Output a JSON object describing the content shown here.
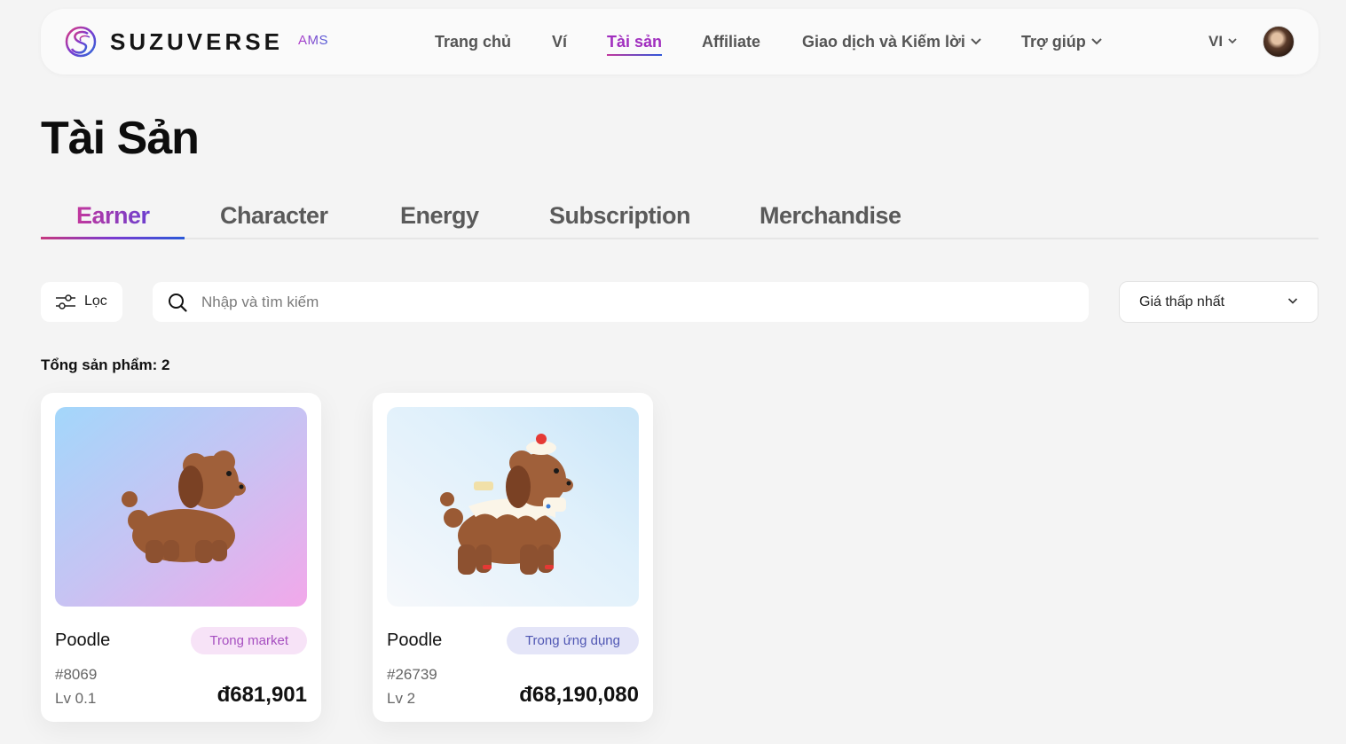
{
  "header": {
    "brand": "SUZUVERSE",
    "brand_suffix": "AMS",
    "nav": {
      "home": "Trang chủ",
      "wallet": "Ví",
      "assets": "Tài sản",
      "affiliate": "Affiliate",
      "trade_earn": "Giao dịch và Kiếm lời",
      "help": "Trợ giúp"
    },
    "language": "VI"
  },
  "page": {
    "title": "Tài Sản",
    "tabs": [
      "Earner",
      "Character",
      "Energy",
      "Subscription",
      "Merchandise"
    ],
    "active_tab": "Earner"
  },
  "filters": {
    "filter_label": "Lọc",
    "search_placeholder": "Nhập và tìm kiếm",
    "sort_value": "Giá thấp nhất"
  },
  "summary": {
    "total_label": "Tổng sản phẩm: 2"
  },
  "cards": [
    {
      "name": "Poodle",
      "badge": "Trong market",
      "token": "#8069",
      "level": "Lv 0.1",
      "price": "đ681,901",
      "badge_bg": "#f7e3f7",
      "badge_color": "#a64fc0"
    },
    {
      "name": "Poodle",
      "badge": "Trong ứng dụng",
      "token": "#26739",
      "level": "Lv 2",
      "price": "đ68,190,080",
      "badge_bg": "#e4e5f8",
      "badge_color": "#4f56b3"
    }
  ],
  "colors": {
    "accent_gradient_start": "#c2379d",
    "accent_gradient_end": "#2f56d9",
    "background": "#f4f4f4"
  }
}
